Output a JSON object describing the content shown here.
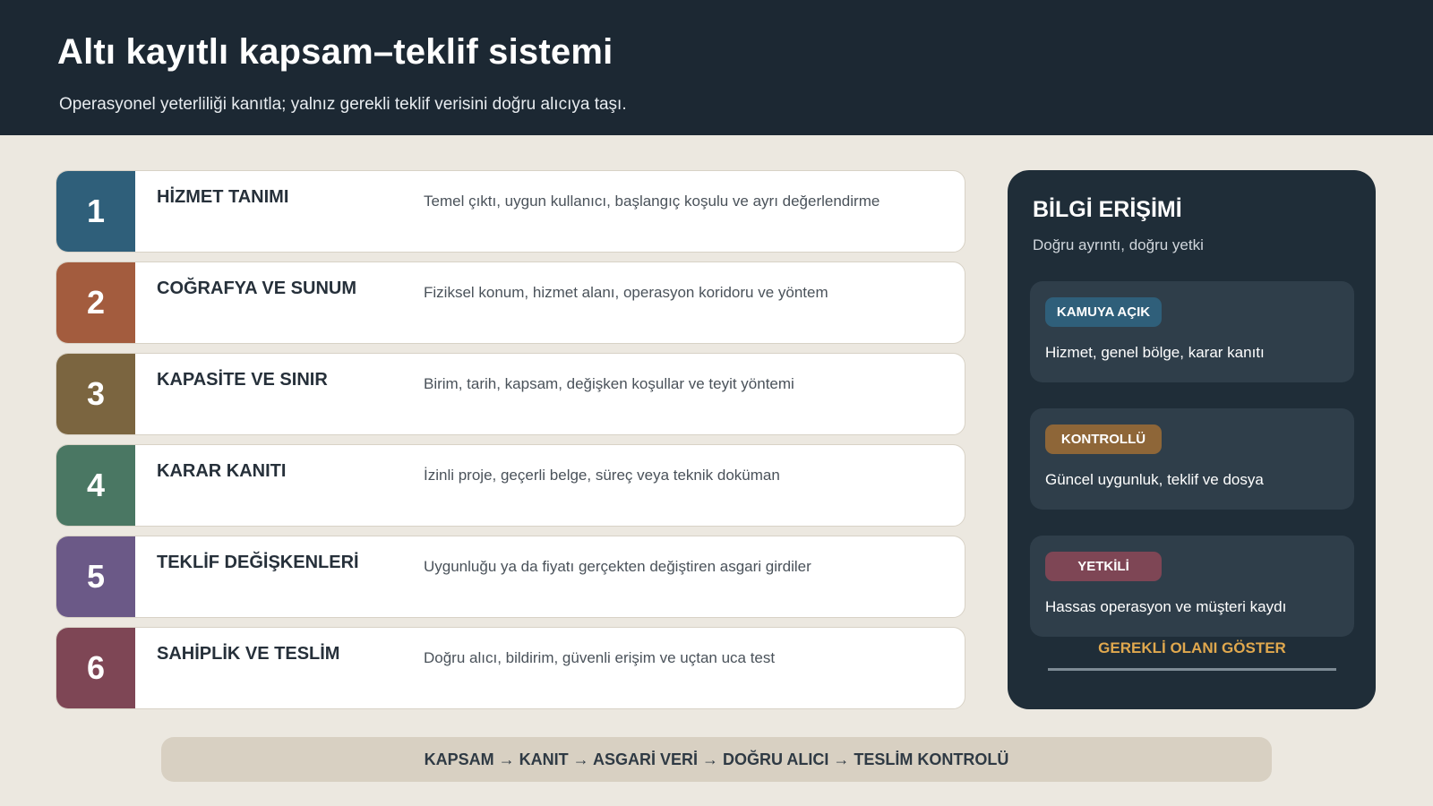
{
  "header": {
    "title": "Altı kayıtlı kapsam–teklif sistemi",
    "subtitle": "Operasyonel yeterliliği kanıtla; yalnız gerekli teklif verisini doğru alıcıya taşı."
  },
  "steps": [
    {
      "number": "1",
      "title": "HİZMET TANIMI",
      "description": "Temel çıktı, uygun kullanıcı, başlangıç koşulu ve ayrı değerlendirme",
      "color": "#2f5f7a"
    },
    {
      "number": "2",
      "title": "COĞRAFYA VE SUNUM",
      "description": "Fiziksel konum, hizmet alanı, operasyon koridoru ve yöntem",
      "color": "#a35c3e"
    },
    {
      "number": "3",
      "title": "KAPASİTE VE SINIR",
      "description": "Birim, tarih, kapsam, değişken koşullar ve teyit yöntemi",
      "color": "#7b6540"
    },
    {
      "number": "4",
      "title": "KARAR KANITI",
      "description": "İzinli proje, geçerli belge, süreç veya teknik doküman",
      "color": "#4a7763"
    },
    {
      "number": "5",
      "title": "TEKLİF DEĞİŞKENLERİ",
      "description": "Uygunluğu ya da fiyatı gerçekten değiştiren asgari girdiler",
      "color": "#6b5987"
    },
    {
      "number": "6",
      "title": "SAHİPLİK VE TESLİM",
      "description": "Doğru alıcı, bildirim, güvenli erişim ve uçtan uca test",
      "color": "#7e4655"
    }
  ],
  "panel": {
    "title": "BİLGİ ERİŞİMİ",
    "subtitle": "Doğru ayrıntı, doğru yetki",
    "cards": [
      {
        "badge": "KAMUYA AÇIK",
        "text": "Hizmet, genel bölge, karar kanıtı",
        "badge_color": "#2f5f7a"
      },
      {
        "badge": "KONTROLLÜ",
        "text": "Güncel uygunluk, teklif ve dosya",
        "badge_color": "#8e6638"
      },
      {
        "badge": "YETKİLİ",
        "text": "Hassas operasyon ve müşteri kaydı",
        "badge_color": "#7e4655"
      }
    ],
    "cta_label": "GEREKLİ OLANI GÖSTER"
  },
  "footer": {
    "flow": "KAPSAM → KANIT → ASGARİ VERİ → DOĞRU ALICI → TESLİM KONTROLÜ"
  }
}
